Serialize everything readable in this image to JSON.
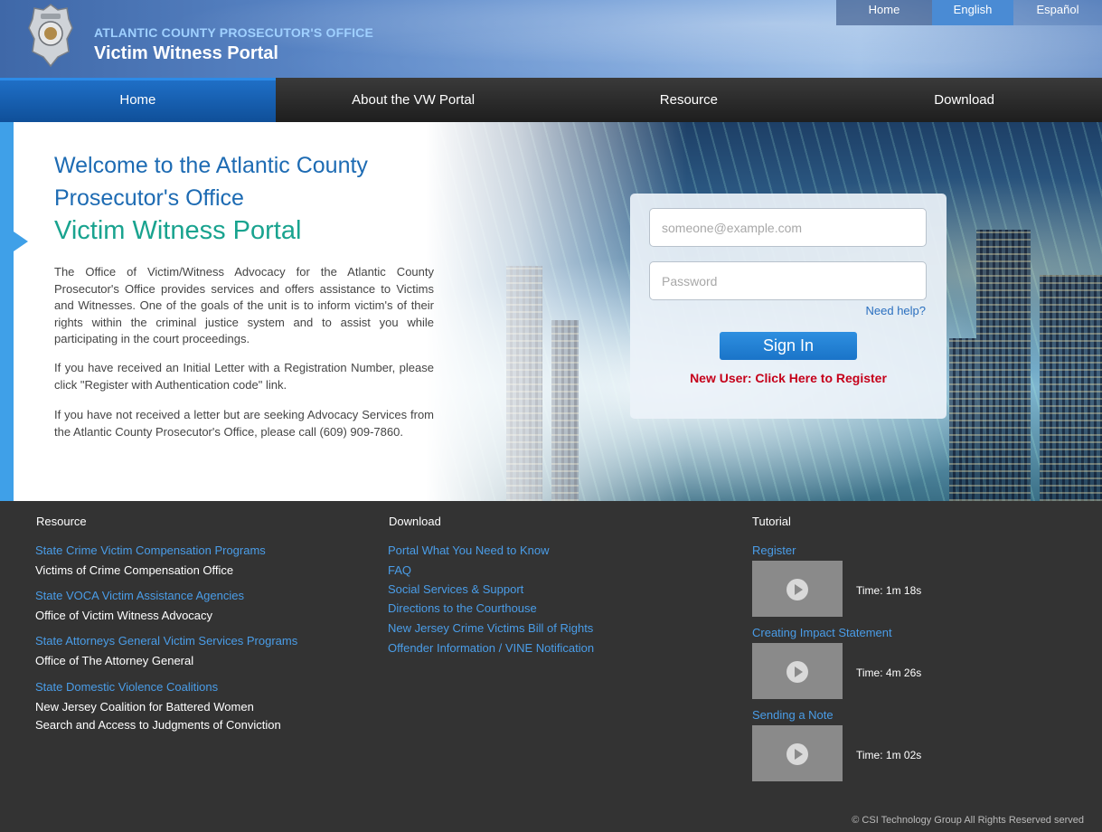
{
  "header": {
    "org_name": "ATLANTIC COUNTY PROSECUTOR'S OFFICE",
    "portal_name": "Victim Witness Portal",
    "top_links": [
      "Home",
      "English",
      "Español"
    ]
  },
  "nav": [
    "Home",
    "About the VW Portal",
    "Resource",
    "Download"
  ],
  "hero": {
    "welcome": "Welcome to the Atlantic County Prosecutor's Office",
    "subtitle": "Victim Witness Portal",
    "para1": "The Office of Victim/Witness Advocacy for the Atlantic County Prosecutor's Office provides services and offers assistance to Victims and Witnesses. One of the goals of the unit is to inform victim's of their rights within the criminal justice system and to assist you while participating in the court proceedings.",
    "para2": "If you have received an Initial Letter with a Registration Number, please click \"Register with Authentication code\" link.",
    "para3": "If you have not received a letter but are seeking Advocacy Services from the Atlantic County Prosecutor's Office, please call (609) 909-7860."
  },
  "login": {
    "email_placeholder": "someone@example.com",
    "password_placeholder": "Password",
    "need_help": "Need help?",
    "sign_in": "Sign In",
    "register": "New User: Click Here to Register"
  },
  "footer": {
    "resource": {
      "heading": "Resource",
      "items": [
        {
          "link": "State Crime Victim Compensation Programs",
          "sub": "Victims of Crime Compensation Office"
        },
        {
          "link": "State VOCA Victim Assistance Agencies",
          "sub": "Office of Victim Witness Advocacy"
        },
        {
          "link": "State Attorneys General Victim Services Programs",
          "sub": "Office of The Attorney General"
        },
        {
          "link": "State Domestic Violence Coalitions",
          "sub": "New Jersey Coalition for Battered Women"
        }
      ],
      "extra": "Search and Access to Judgments of Conviction"
    },
    "download": {
      "heading": "Download",
      "items": [
        "Portal What You Need to Know",
        "FAQ",
        "Social Services & Support",
        "Directions to the Courthouse",
        "New Jersey Crime Victims Bill of Rights",
        "Offender Information / VINE Notification"
      ]
    },
    "tutorial": {
      "heading": "Tutorial",
      "items": [
        {
          "title": "Register",
          "time": "Time: 1m 18s"
        },
        {
          "title": "Creating Impact Statement",
          "time": "Time: 4m 26s"
        },
        {
          "title": "Sending a Note",
          "time": "Time: 1m 02s"
        }
      ]
    },
    "copyright": "© CSI Technology Group All Rights Reserved served"
  }
}
